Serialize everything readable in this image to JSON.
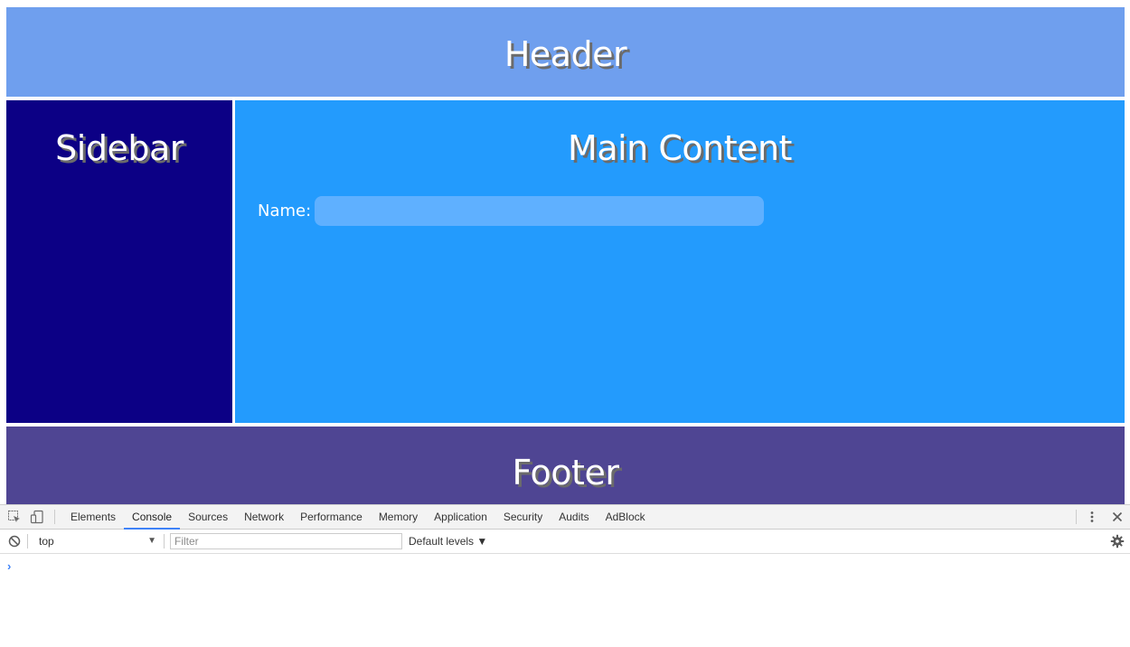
{
  "page": {
    "header_title": "Header",
    "sidebar_title": "Sidebar",
    "main_title": "Main Content",
    "name_label": "Name:",
    "name_value": "",
    "footer_title": "Footer",
    "colors": {
      "header": "#6f9fee",
      "sidebar": "#0c0085",
      "main": "#239bfd",
      "footer": "#4f4593",
      "input": "#5fb0ff"
    }
  },
  "devtools": {
    "icons": [
      "inspect-element-icon",
      "device-toolbar-icon",
      "more-options-icon",
      "close-icon",
      "clear-console-icon",
      "settings-gear-icon"
    ],
    "tabs": [
      {
        "label": "Elements",
        "active": false
      },
      {
        "label": "Console",
        "active": true
      },
      {
        "label": "Sources",
        "active": false
      },
      {
        "label": "Network",
        "active": false
      },
      {
        "label": "Performance",
        "active": false
      },
      {
        "label": "Memory",
        "active": false
      },
      {
        "label": "Application",
        "active": false
      },
      {
        "label": "Security",
        "active": false
      },
      {
        "label": "Audits",
        "active": false
      },
      {
        "label": "AdBlock",
        "active": false
      }
    ],
    "context": "top",
    "filter_placeholder": "Filter",
    "levels_label": "Default levels ▼",
    "prompt": "›",
    "accent_color": "#3e82f7"
  }
}
